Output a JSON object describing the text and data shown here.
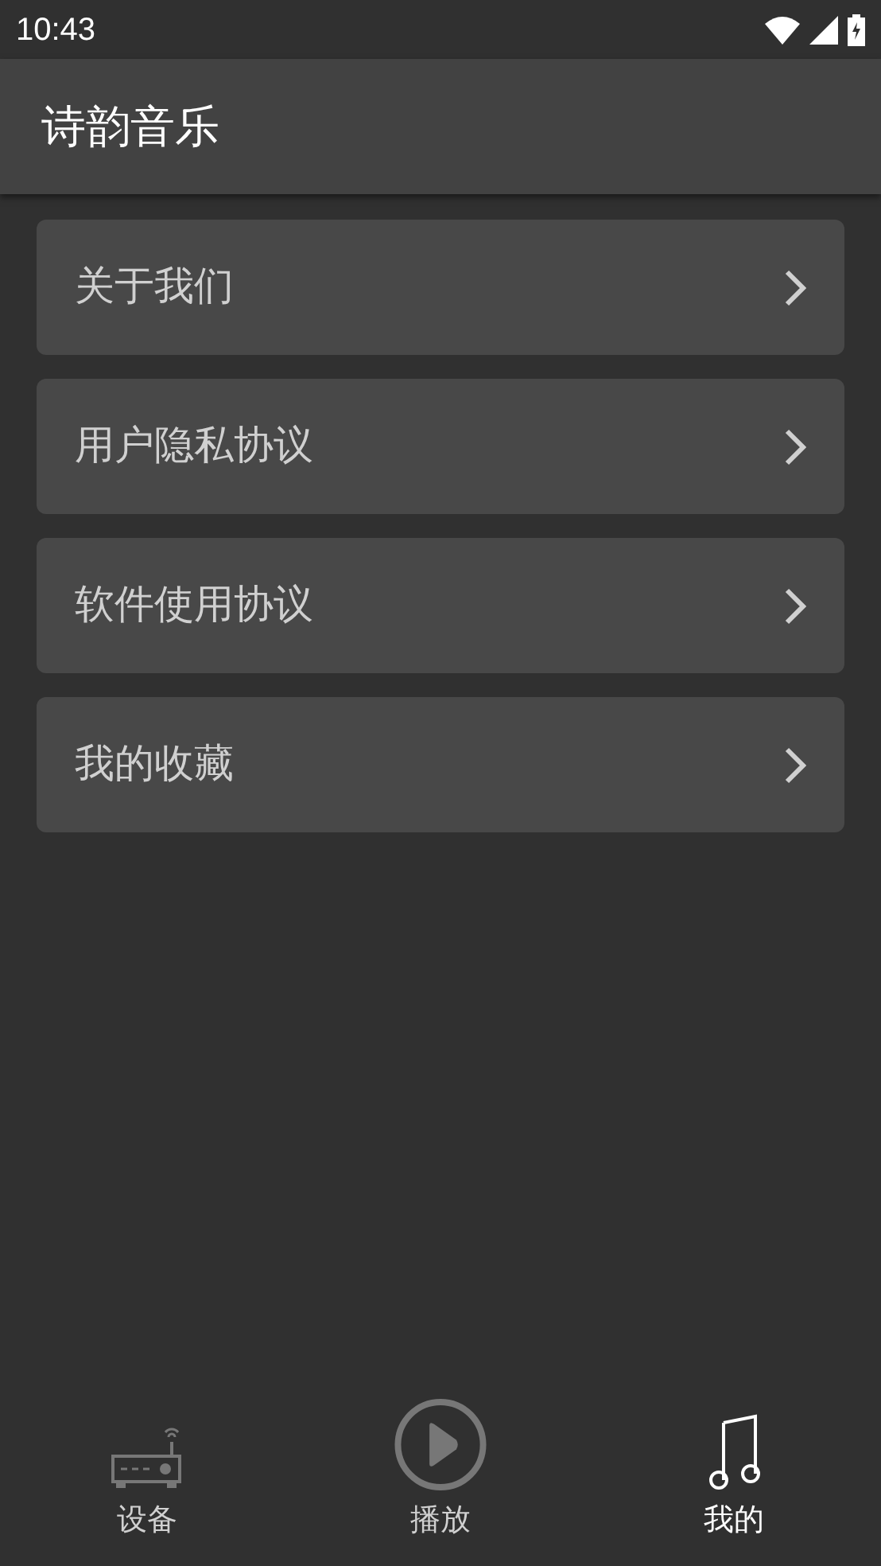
{
  "status_bar": {
    "time": "10:43"
  },
  "app_bar": {
    "title": "诗韵音乐"
  },
  "menu": [
    {
      "label": "关于我们"
    },
    {
      "label": "用户隐私协议"
    },
    {
      "label": "软件使用协议"
    },
    {
      "label": "我的收藏"
    }
  ],
  "bottom_nav": [
    {
      "label": "设备",
      "kind": "device",
      "selected": false
    },
    {
      "label": "播放",
      "kind": "play",
      "selected": false
    },
    {
      "label": "我的",
      "kind": "note",
      "selected": true
    }
  ]
}
